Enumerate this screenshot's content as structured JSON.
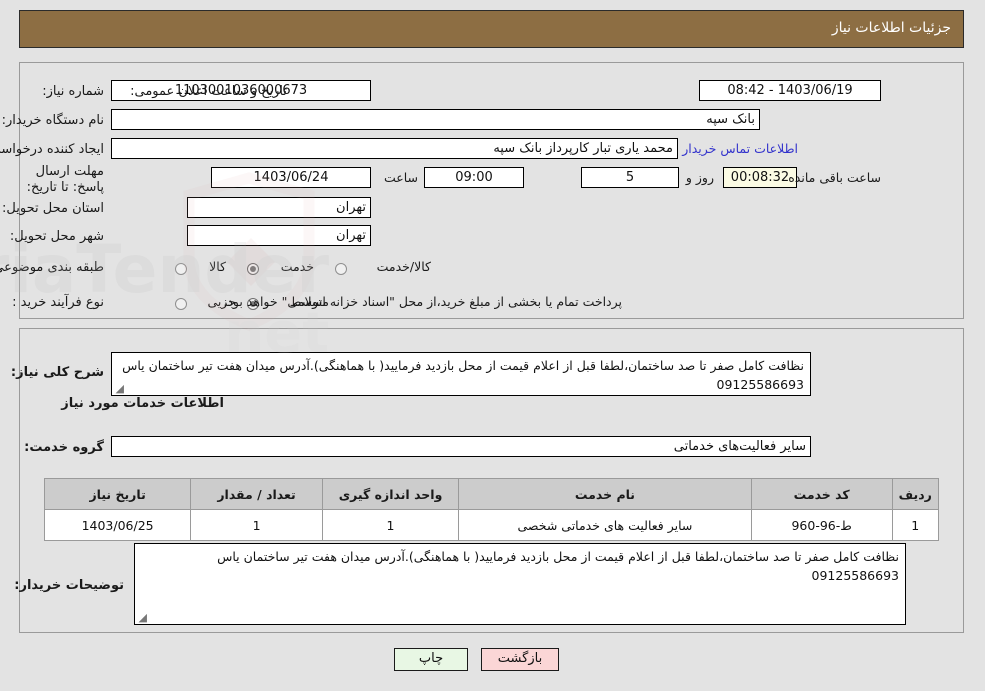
{
  "header": {
    "title": "جزئیات اطلاعات نیاز"
  },
  "colors": {
    "header_bar": "#8d6e43",
    "page_bg": "#e3e3e3",
    "link": "#3333cc",
    "countdown_bg": "#fbfbe4",
    "print_btn_bg": "#e8f7e4",
    "back_btn_bg": "#fbd6d6",
    "table_header_bg": "#cccccc"
  },
  "form": {
    "need_number_label": "شماره نیاز:",
    "need_number_value": "1103001036000673",
    "announce_datetime_label": "تاریخ و ساعت اعلان عمومی:",
    "announce_datetime_value": "1403/06/19 - 08:42",
    "buyer_org_label": "نام دستگاه خریدار:",
    "buyer_org_value": "بانک سپه",
    "creator_label": "ایجاد کننده درخواست:",
    "creator_value": "محمد یاری تبار کارپرداز بانک سپه",
    "buyer_contact_link": "اطلاعات تماس خریدار",
    "deadline_label": "مهلت ارسال پاسخ: تا تاریخ:",
    "deadline_date": "1403/06/24",
    "hour_label": "ساعت",
    "deadline_time": "09:00",
    "days_value": "5",
    "days_label": "روز و",
    "countdown_value": "00:08:32",
    "remaining_label": "ساعت باقی مانده",
    "province_label": "استان محل تحویل:",
    "province_value": "تهران",
    "city_label": "شهر محل تحویل:",
    "city_value": "تهران",
    "classification_label": "طبقه بندی موضوعی:",
    "classification_options": [
      {
        "label": "کالا",
        "selected": false
      },
      {
        "label": "خدمت",
        "selected": true
      },
      {
        "label": "کالا/خدمت",
        "selected": false
      }
    ],
    "process_label": "نوع فرآیند خرید :",
    "process_options": [
      {
        "label": "جزیی",
        "selected": false
      },
      {
        "label": "متوسط",
        "selected": true
      }
    ],
    "payment_note": "پرداخت تمام یا بخشی از مبلغ خرید،از محل \"اسناد خزانه اسلامی\" خواهد بود."
  },
  "details": {
    "need_summary_label": "شرح کلی نیاز:",
    "need_summary_value": "نظافت کامل صفر تا صد ساختمان،لطفا قبل از اعلام قیمت از محل بازدید فرمایید( با هماهنگی).آدرس میدان هفت تیر ساختمان یاس 09125586693",
    "services_section_title": "اطلاعات خدمات مورد نیاز",
    "service_group_label": "گروه خدمت:",
    "service_group_value": "سایر فعالیت‌های خدماتی",
    "buyer_notes_label": "توضیحات خریدار:",
    "buyer_notes_value": "نظافت کامل صفر تا صد ساختمان،لطفا قبل از اعلام قیمت از محل بازدید فرمایید( با هماهنگی).آدرس میدان هفت تیر ساختمان یاس 09125586693"
  },
  "table": {
    "columns": [
      "ردیف",
      "کد خدمت",
      "نام خدمت",
      "واحد اندازه گیری",
      "تعداد / مقدار",
      "تاریخ نیاز"
    ],
    "rows": [
      {
        "row_no": "1",
        "service_code": "ط-96-960",
        "service_name": "سایر فعالیت های خدماتی شخصی",
        "unit": "1",
        "quantity": "1",
        "need_date": "1403/06/25"
      }
    ]
  },
  "footer": {
    "print_label": "چاپ",
    "back_label": "بازگشت"
  }
}
